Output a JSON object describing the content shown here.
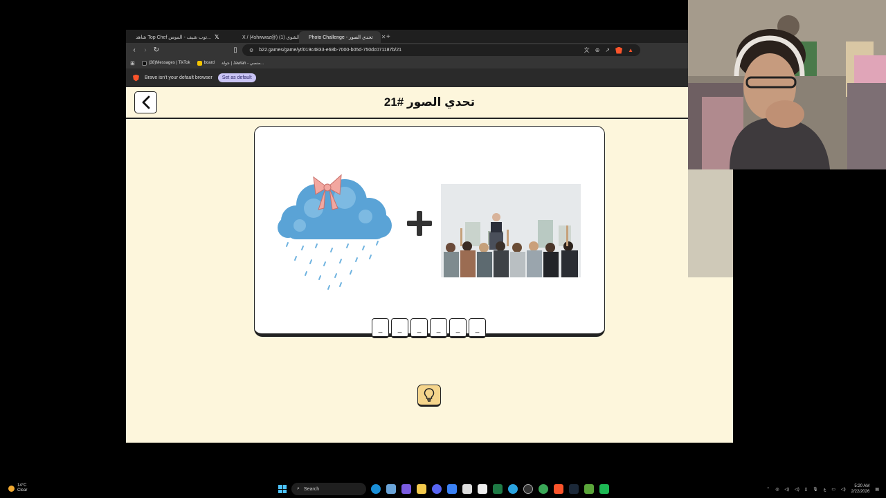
{
  "browser": {
    "tabs": [
      {
        "label": "شاهد Top Chef توب شيف - الموس...",
        "color": "#1db954",
        "active": false
      },
      {
        "label": "",
        "color": "#000000",
        "active": false,
        "icon": "x-icon"
      },
      {
        "label": "X / (4shwwaz@) الشوي (1)",
        "color": "#111111",
        "active": false
      },
      {
        "label": "Photo Challenge - تحدي الصور",
        "color": "#f0a830",
        "active": true
      }
    ],
    "new_tab": "+",
    "url": "b22.games/game/yt/019c4833-e68b-7000-b05d-750dc071187b/21",
    "bookmarks": [
      {
        "label": "(38)Messages | TikTok",
        "color": "#111111"
      },
      {
        "label": "board",
        "color": "#f5c400"
      },
      {
        "label": "جولة | Jawlah - منصي...",
        "color": "#444444"
      }
    ],
    "infobar": {
      "message": "Brave isn't your default browser",
      "button": "Set as default"
    }
  },
  "game": {
    "title": "تحدي الصور #21",
    "letter_slots": [
      "_",
      "_",
      "_",
      "_",
      "_",
      "_"
    ],
    "colors": {
      "background": "#fdf6dc",
      "hint": "#f5d58c",
      "border": "#222222"
    }
  },
  "taskbar": {
    "weather_temp": "14°C",
    "weather_desc": "Clear",
    "search": "Search",
    "time": "5:20 AM",
    "date": "2/22/2026",
    "lang": "ع"
  }
}
